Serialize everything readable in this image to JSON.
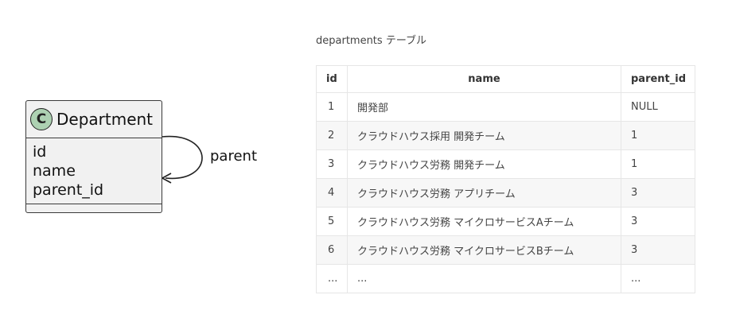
{
  "diagram": {
    "class_icon_letter": "C",
    "class_name": "Department",
    "attributes": [
      "id",
      "name",
      "parent_id"
    ],
    "association_label": "parent",
    "colors": {
      "class_icon_fill": "#add1b2",
      "class_box_fill": "#f1f1f1"
    }
  },
  "table": {
    "caption": "departments テーブル",
    "headers": {
      "id": "id",
      "name": "name",
      "parent_id": "parent_id"
    },
    "rows": [
      {
        "id": "1",
        "name": "開発部",
        "parent_id": "NULL"
      },
      {
        "id": "2",
        "name": "クラウドハウス採用 開発チーム",
        "parent_id": "1"
      },
      {
        "id": "3",
        "name": "クラウドハウス労務 開発チーム",
        "parent_id": "1"
      },
      {
        "id": "4",
        "name": "クラウドハウス労務 アプリチーム",
        "parent_id": "3"
      },
      {
        "id": "5",
        "name": "クラウドハウス労務 マイクロサービスAチーム",
        "parent_id": "3"
      },
      {
        "id": "6",
        "name": "クラウドハウス労務 マイクロサービスBチーム",
        "parent_id": "3"
      },
      {
        "id": "...",
        "name": "...",
        "parent_id": "..."
      }
    ]
  }
}
